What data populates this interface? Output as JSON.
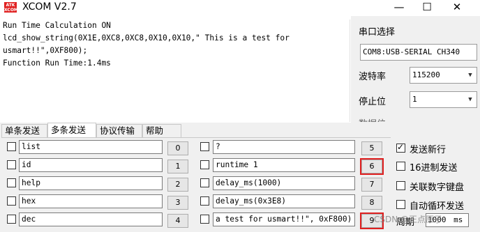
{
  "window": {
    "title": "XCOM V2.7",
    "logo_text": "ATK XCOM",
    "minimize_glyph": "—",
    "maximize_glyph": "☐",
    "close_glyph": "✕"
  },
  "receive": {
    "lines": [
      "",
      "Run Time Calculation ON",
      "",
      "",
      "lcd_show_string(0X1E,0XC8,0XC8,0X10,0X10,\" This is a test for",
      "usmart!!\",0XF800);",
      "Function Run Time:1.4ms"
    ]
  },
  "serial_panel": {
    "port_label": "串口选择",
    "port_value": "COM8:USB-SERIAL CH340",
    "baud_label": "波特率",
    "baud_value": "115200",
    "stopbits_label": "停止位",
    "stopbits_value": "1",
    "databits_label": "数据位"
  },
  "tabs": [
    "单条发送",
    "多条发送",
    "协议传输",
    "帮助"
  ],
  "multi_send": {
    "left": [
      {
        "text": "list",
        "button": "0"
      },
      {
        "text": "id",
        "button": "1"
      },
      {
        "text": "help",
        "button": "2"
      },
      {
        "text": "hex",
        "button": "3"
      },
      {
        "text": "dec",
        "button": "4"
      }
    ],
    "right": [
      {
        "text": "?",
        "button": "5"
      },
      {
        "text": "runtime 1",
        "button": "6"
      },
      {
        "text": "delay_ms(1000)",
        "button": "7"
      },
      {
        "text": "delay_ms(0x3E8)",
        "button": "8"
      },
      {
        "text": " a test for usmart!!\", 0xF800)",
        "button": "9"
      }
    ]
  },
  "options": {
    "send_newline": "发送新行",
    "hex_send": "16进制发送",
    "link_keypad": "关联数字键盘",
    "auto_loop": "自动循环发送",
    "period_label": "周期",
    "period_value": "1000",
    "period_unit": "ms"
  },
  "watermark": "CSDN @正点原子"
}
